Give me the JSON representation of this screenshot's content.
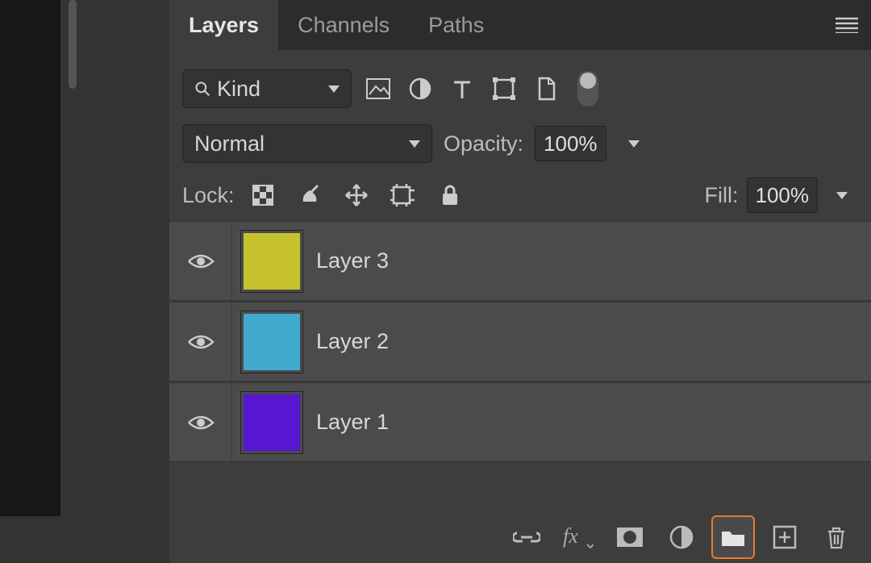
{
  "tabs": {
    "layers": "Layers",
    "channels": "Channels",
    "paths": "Paths"
  },
  "filter": {
    "kind_label": "Kind",
    "icons": [
      "image-filter-icon",
      "adjustment-filter-icon",
      "type-filter-icon",
      "shape-filter-icon",
      "smartobject-filter-icon"
    ]
  },
  "blend": {
    "mode": "Normal",
    "opacity_label": "Opacity:",
    "opacity_value": "100%"
  },
  "lock": {
    "label": "Lock:",
    "fill_label": "Fill:",
    "fill_value": "100%"
  },
  "layers": [
    {
      "name": "Layer 3",
      "color": "#c6c22d"
    },
    {
      "name": "Layer 2",
      "color": "#42a9cf"
    },
    {
      "name": "Layer 1",
      "color": "#5716d0"
    }
  ],
  "bottom_icons": [
    "link-icon",
    "fx-icon",
    "mask-icon",
    "adjustment-icon",
    "group-icon",
    "new-icon",
    "trash-icon"
  ]
}
